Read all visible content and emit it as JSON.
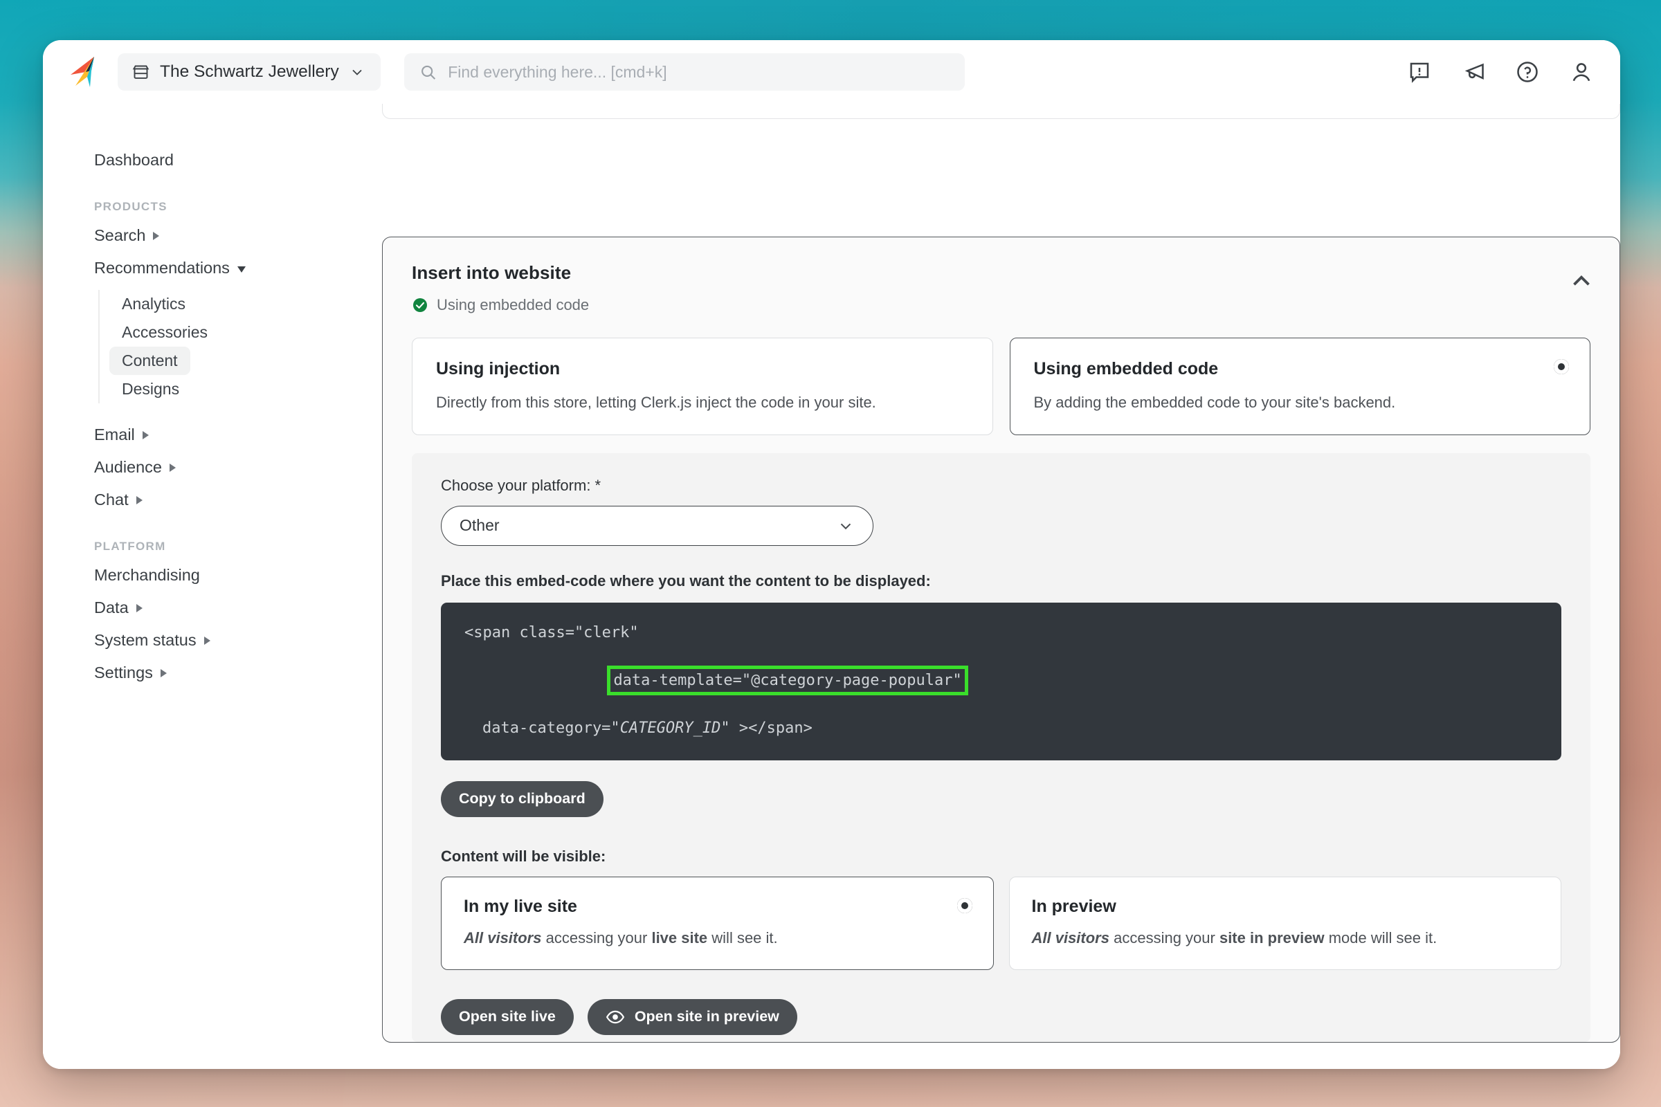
{
  "topbar": {
    "logo_name": "clerk-logo",
    "store_switcher": {
      "store_icon": "store-icon",
      "name": "The Schwartz Jewellery",
      "chevron": "chevron-down-icon"
    },
    "search": {
      "icon": "search-icon",
      "value": "",
      "placeholder": "Find everything here... [cmd+k]"
    },
    "actions": [
      {
        "icon": "alert-bubble-icon",
        "label": "Notifications"
      },
      {
        "icon": "megaphone-icon",
        "label": "Announcements"
      },
      {
        "icon": "help-circle-icon",
        "label": "Help"
      },
      {
        "icon": "user-avatar-icon",
        "label": "Account"
      }
    ]
  },
  "sidebar": {
    "dashboard": "Dashboard",
    "group_products": "PRODUCTS",
    "group_platform": "PLATFORM",
    "products": [
      {
        "label": "Search",
        "caret": "right"
      },
      {
        "label": "Recommendations",
        "caret": "down"
      }
    ],
    "subnav": [
      {
        "label": "Analytics",
        "active": false
      },
      {
        "label": "Accessories",
        "active": false
      },
      {
        "label": "Content",
        "active": true
      },
      {
        "label": "Designs",
        "active": false
      }
    ],
    "products_rest": [
      {
        "label": "Email",
        "caret": "right"
      },
      {
        "label": "Audience",
        "caret": "right"
      },
      {
        "label": "Chat",
        "caret": "right"
      }
    ],
    "platform": [
      {
        "label": "Merchandising",
        "caret": "none"
      },
      {
        "label": "Data",
        "caret": "right"
      },
      {
        "label": "System status",
        "caret": "right"
      },
      {
        "label": "Settings",
        "caret": "right"
      }
    ]
  },
  "panel": {
    "title": "Insert into website",
    "status_icon": "check-circle-icon",
    "status_text": "Using embedded code",
    "collapse_icon": "chevron-up-icon",
    "methods": [
      {
        "title": "Using injection",
        "desc": "Directly from this store, letting Clerk.js inject the code in your site.",
        "selected": false
      },
      {
        "title": "Using embedded code",
        "desc": "By adding the embedded code to your site's backend.",
        "selected": true
      }
    ],
    "platform_field": {
      "label": "Choose your platform: *",
      "value": "Other",
      "chevron": "chevron-down-icon"
    },
    "embed_label": "Place this embed-code where you want the content to be displayed:",
    "code": {
      "line1": "<span class=\"clerk\"",
      "line2_highlighted": "data-template=\"@category-page-popular\"",
      "line3_prefix": "data-category=\"",
      "line3_var": "CATEGORY_ID",
      "line3_suffix": "\" ></span>",
      "highlight_color": "#3ade2b",
      "background": "#32373d"
    },
    "copy_button": "Copy to clipboard",
    "visible_label": "Content will be visible:",
    "visibility": [
      {
        "title": "In my live site",
        "desc_em": "All visitors",
        "desc_mid": " accessing your ",
        "desc_strong": "live site",
        "desc_end": " will see it.",
        "selected": true
      },
      {
        "title": "In preview",
        "desc_em": "All visitors",
        "desc_mid": " accessing your ",
        "desc_strong": "site in preview",
        "desc_end": " mode will see it.",
        "selected": false
      }
    ],
    "open_live_button": "Open site live",
    "open_preview_button": "Open site in preview",
    "open_preview_icon": "eye-icon"
  }
}
